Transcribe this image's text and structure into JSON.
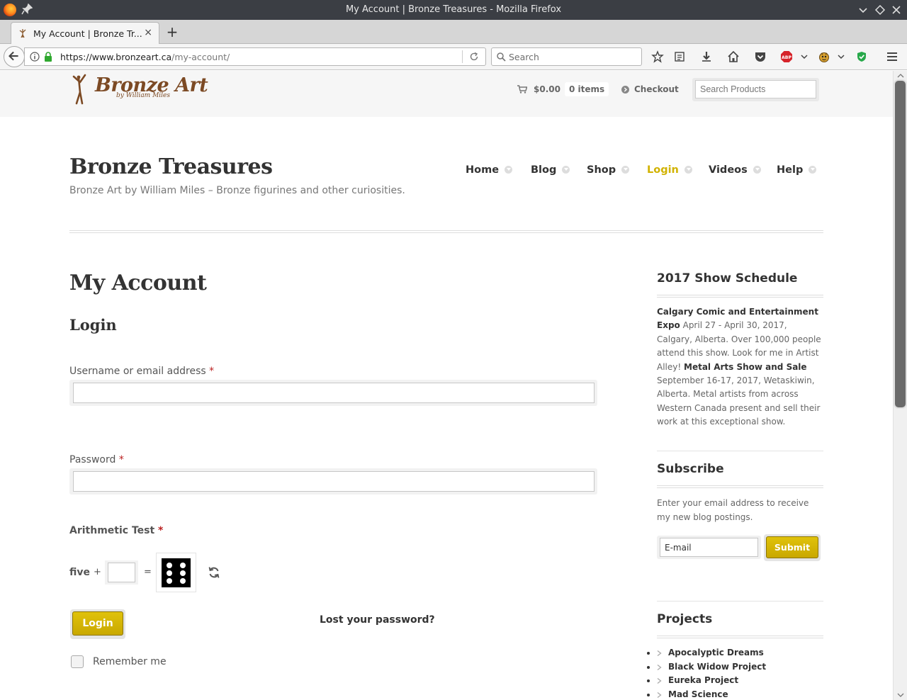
{
  "window": {
    "title": "My Account | Bronze Treasures - Mozilla Firefox"
  },
  "tab": {
    "label": "My Account | Bronze Tr...",
    "close": "×",
    "new_tab": "+"
  },
  "browser": {
    "url_host": "https://www.bronzeart.ca",
    "url_path": "/my-account/",
    "search_placeholder": "Search",
    "abp_label": "ABP"
  },
  "header": {
    "logo_text": "Bronze Art",
    "logo_sub": "by William Miles",
    "cart_total": "$0.00",
    "cart_items": "0 items",
    "checkout_label": "Checkout",
    "product_search_placeholder": "Search Products"
  },
  "site": {
    "title": "Bronze Treasures",
    "tagline": "Bronze Art by William Miles – Bronze figurines and other curiosities."
  },
  "nav": {
    "items": [
      {
        "label": "Home"
      },
      {
        "label": "Blog"
      },
      {
        "label": "Shop"
      },
      {
        "label": "Login",
        "active": true
      },
      {
        "label": "Videos"
      },
      {
        "label": "Help"
      }
    ],
    "active_color": "#d1b200"
  },
  "main": {
    "page_title": "My Account",
    "section_title": "Login",
    "username_label": "Username or email address",
    "password_label": "Password",
    "required_mark": "*",
    "arithmetic_label": "Arithmetic Test",
    "arithmetic_operand": "five",
    "arithmetic_plus": "+",
    "arithmetic_equals": "=",
    "arithmetic_dice_value": 6,
    "login_button": "Login",
    "lost_password": "Lost your password?",
    "remember_me": "Remember me"
  },
  "sidebar": {
    "schedule_title": "2017 Show Schedule",
    "schedule": [
      {
        "name": "Calgary Comic and Entertainment Expo",
        "details": "April 27 - April 30, 2017, Calgary, Alberta. Over 100,000 people attend this show. Look for me in Artist Alley!"
      },
      {
        "name": "Metal Arts Show and Sale",
        "details": "September 16-17, 2017, Wetaskiwin, Alberta. Metal artists from across Western Canada present and sell their work at this exceptional show."
      }
    ],
    "subscribe_title": "Subscribe",
    "subscribe_text": "Enter your email address to receive my new blog postings.",
    "email_value": "E-mail",
    "submit_label": "Submit",
    "projects_title": "Projects",
    "projects": [
      {
        "label": "Apocalyptic Dreams"
      },
      {
        "label": "Black Widow Project"
      },
      {
        "label": "Eureka Project"
      },
      {
        "label": "Mad Science"
      }
    ]
  },
  "colors": {
    "accent_gold": "#d1b200",
    "logo_bronze": "#7c4a24",
    "titlebar": "#3b3e44"
  }
}
